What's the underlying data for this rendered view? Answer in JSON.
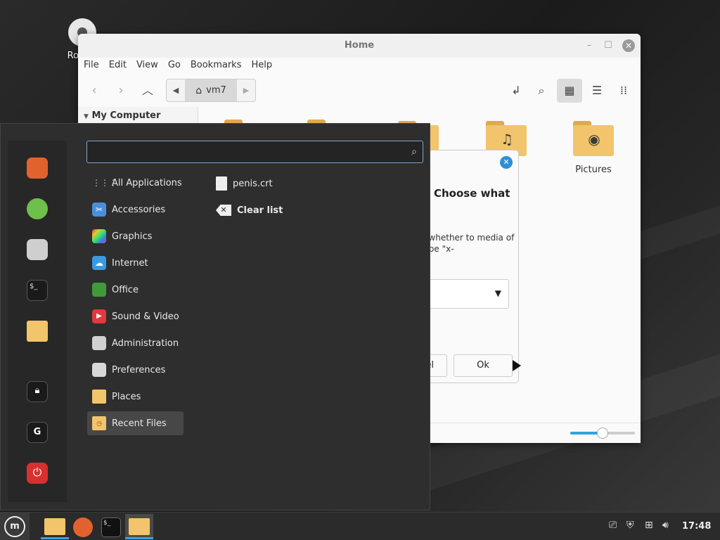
{
  "desktop": {
    "icon_label": "Rocky-"
  },
  "file_manager": {
    "title": "Home",
    "menu": [
      "File",
      "Edit",
      "Go",
      "Bookmarks",
      "Help"
    ],
    "path_crumb": "vm7",
    "sidebar_header": "My Computer",
    "folders": [
      {
        "label": "",
        "icon": "folder-icon"
      },
      {
        "label": "",
        "icon": "folder-icon"
      },
      {
        "label": "",
        "icon": "folder-icon"
      },
      {
        "label": "",
        "icon": "folder-music-icon"
      },
      {
        "label": "Pictures",
        "icon": "folder-pictures-icon"
      }
    ],
    "zoom_level": 0.5
  },
  "dialog": {
    "heading": "Choose what",
    "text": "d whether to media of type \"x-",
    "ok_label": "Ok",
    "cancel_label": "el"
  },
  "menu": {
    "search_value": "",
    "categories": [
      {
        "label": "All Applications",
        "icon": "grid-icon",
        "color": "#3a3a3a"
      },
      {
        "label": "Accessories",
        "icon": "scissors-icon",
        "color": "#4a8fdb"
      },
      {
        "label": "Graphics",
        "icon": "palette-icon",
        "color": "#c55dd6"
      },
      {
        "label": "Internet",
        "icon": "cloud-icon",
        "color": "#3a9ae0"
      },
      {
        "label": "Office",
        "icon": "office-icon",
        "color": "#3f9a3a"
      },
      {
        "label": "Sound & Video",
        "icon": "play-icon",
        "color": "#e0393e"
      },
      {
        "label": "Administration",
        "icon": "admin-icon",
        "color": "#d0d0d0"
      },
      {
        "label": "Preferences",
        "icon": "preferences-icon",
        "color": "#d8d8d8"
      },
      {
        "label": "Places",
        "icon": "folder-icon",
        "color": "#f2c46b"
      },
      {
        "label": "Recent Files",
        "icon": "recent-folder-icon",
        "color": "#f2c46b"
      }
    ],
    "recent_file": "penis.crt",
    "clear_list": "Clear list"
  },
  "taskbar": {
    "clock": "17:48"
  }
}
